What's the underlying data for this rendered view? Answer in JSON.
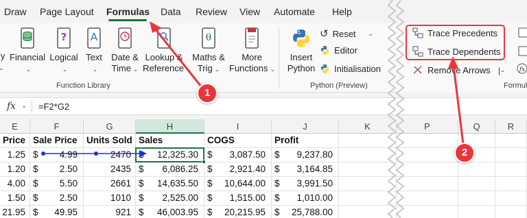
{
  "tabs": [
    "Draw",
    "Page Layout",
    "Formulas",
    "Data",
    "Review",
    "View",
    "Automate",
    "Help"
  ],
  "active_tab": "Formulas",
  "ribbon": {
    "function_library": {
      "partial_label": "ly",
      "financial": "Financial",
      "logical": "Logical",
      "text": "Text",
      "date_time": [
        "Date &",
        "Time"
      ],
      "lookup_reference": [
        "Lookup &",
        "Reference"
      ],
      "maths_trig": [
        "Maths &",
        "Trig"
      ],
      "more_functions": [
        "More",
        "Functions"
      ],
      "group_label": "Function Library"
    },
    "python": {
      "insert_python": [
        "Insert",
        "Python"
      ],
      "reset": "Reset",
      "editor": "Editor",
      "initialisation": "Initialisation",
      "group_label": "Python (Preview)"
    },
    "formula_auditing": {
      "trace_precedents": "Trace Precedents",
      "trace_dependents": "Trace Dependents",
      "remove_arrows": "Remove Arrows",
      "group_label_partial": "Formula"
    }
  },
  "formula_bar": {
    "fx": "fx",
    "formula": "=F2*G2"
  },
  "columns": [
    "E",
    "F",
    "G",
    "H",
    "I",
    "J",
    "K",
    "P",
    "Q",
    "R"
  ],
  "selected_column": "H",
  "headers": {
    "e": "t Price",
    "f": "Sale Price",
    "g": "Units Sold",
    "h": "Sales",
    "i": "COGS",
    "j": "Profit"
  },
  "rows": [
    {
      "cost": "1.25",
      "sale_cur": "$",
      "sale": "4.99",
      "units": "2470",
      "sales_cur": "$",
      "sales": "12,325.30",
      "cogs_cur": "$",
      "cogs": "3,087.50",
      "profit_cur": "$",
      "profit": "9,237.80"
    },
    {
      "cost": "1.20",
      "sale_cur": "$",
      "sale": "2.50",
      "units": "2435",
      "sales_cur": "$",
      "sales": "6,086.25",
      "cogs_cur": "$",
      "cogs": "2,921.40",
      "profit_cur": "$",
      "profit": "3,164.85"
    },
    {
      "cost": "4.00",
      "sale_cur": "$",
      "sale": "5.50",
      "units": "2661",
      "sales_cur": "$",
      "sales": "14,635.50",
      "cogs_cur": "$",
      "cogs": "10,644.00",
      "profit_cur": "$",
      "profit": "3,991.50"
    },
    {
      "cost": "1.50",
      "sale_cur": "$",
      "sale": "2.50",
      "units": "1010",
      "sales_cur": "$",
      "sales": "2,525.00",
      "cogs_cur": "$",
      "cogs": "1,515.00",
      "profit_cur": "$",
      "profit": "1,010.00"
    },
    {
      "cost": "21.95",
      "sale_cur": "$",
      "sale": "49.95",
      "units": "921",
      "sales_cur": "$",
      "sales": "46,003.95",
      "cogs_cur": "$",
      "cogs": "20,215.95",
      "profit_cur": "$",
      "profit": "25,788.00"
    }
  ],
  "callouts": [
    "1",
    "2"
  ],
  "colors": {
    "accent_green": "#1e7145",
    "annotation_red": "#e8363b",
    "trace_arrow_blue": "#1f2de0"
  }
}
